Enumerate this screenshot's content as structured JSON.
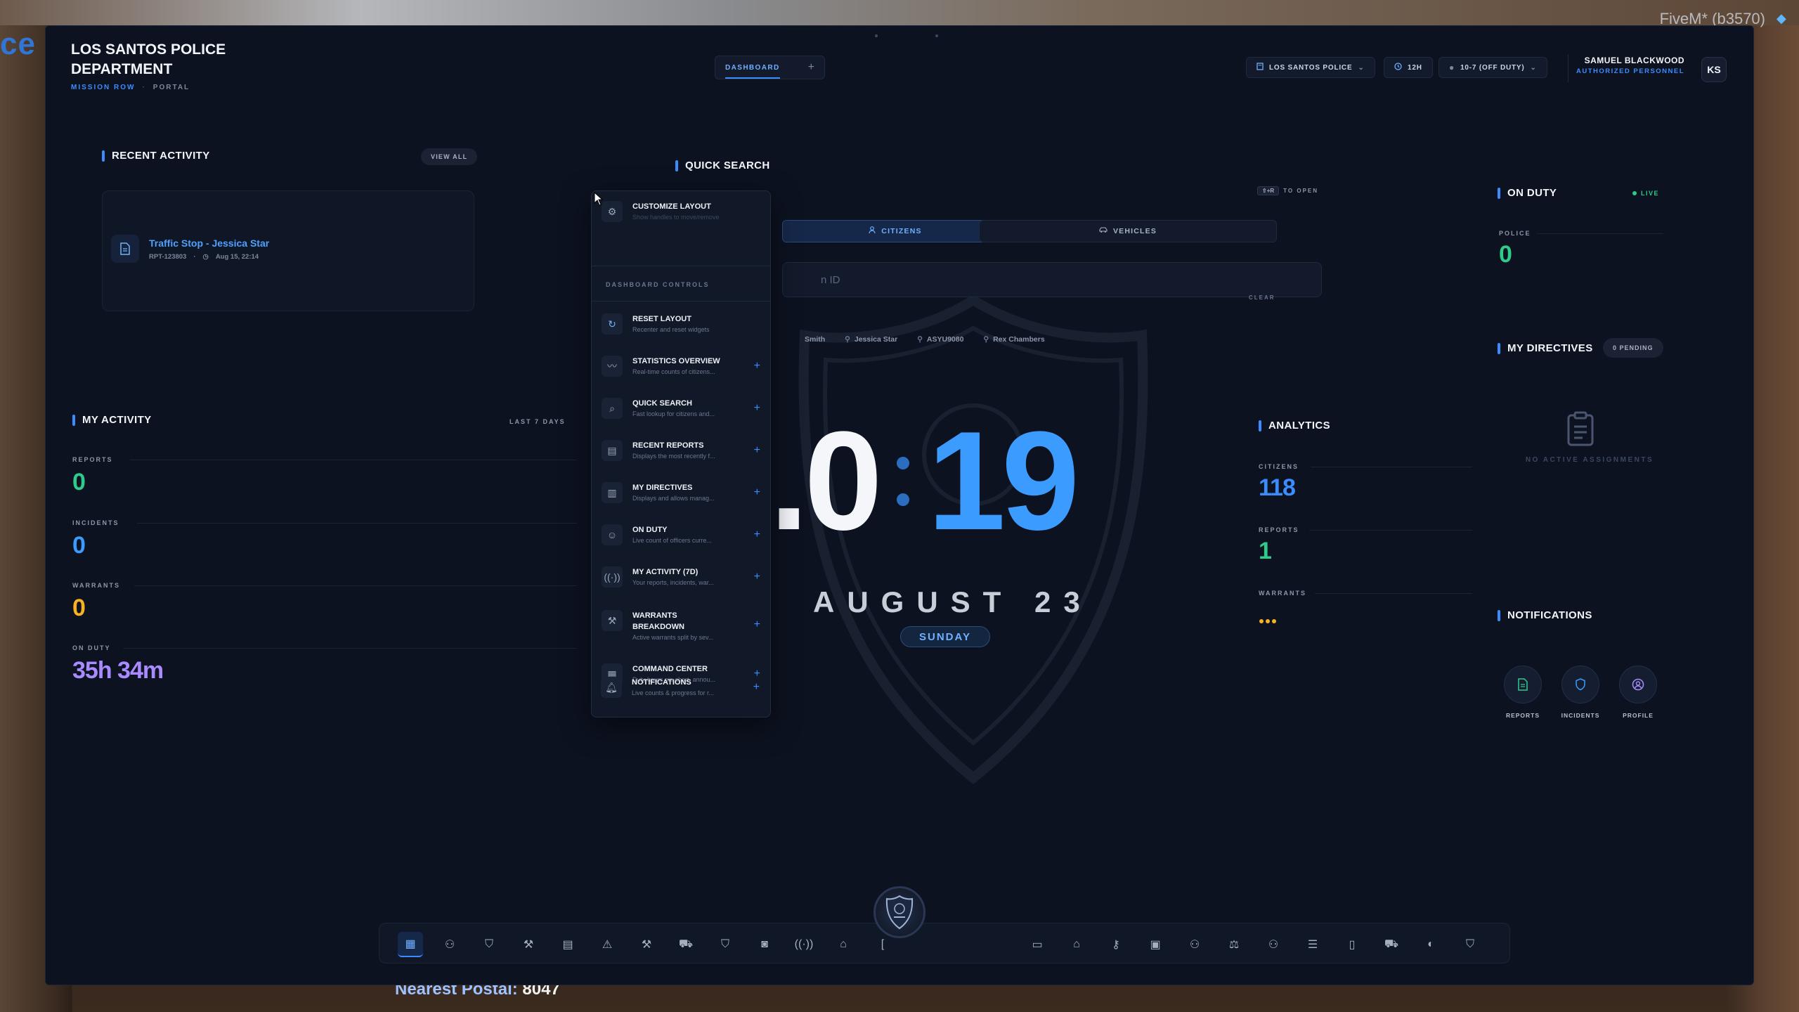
{
  "background": {
    "left_text": "ce S",
    "top_right_text": "_FiveM* (b3570)",
    "bottom_text_label": "Nearest Postal:",
    "bottom_text_value": "8047"
  },
  "header": {
    "title": "LOS SANTOS POLICE DEPARTMENT",
    "sub_primary": "MISSION ROW",
    "sub_separator": "·",
    "sub_secondary": "PORTAL",
    "tab_label": "DASHBOARD",
    "tab_add": "+",
    "department_select": "LOS SANTOS POLICE",
    "time_format": "12H",
    "status_select": "10-7 (OFF DUTY)",
    "user_name": "SAMUEL BLACKWOOD",
    "user_role": "AUTHORIZED PERSONNEL",
    "avatar_initials": "KS"
  },
  "recent_activity": {
    "title": "RECENT ACTIVITY",
    "view_all": "VIEW ALL",
    "item_title": "Traffic Stop - Jessica Star",
    "item_id": "RPT-123803",
    "item_sep": "·",
    "item_time": "Aug 15, 22:14"
  },
  "my_activity": {
    "title": "MY ACTIVITY",
    "range": "LAST 7 DAYS",
    "reports_label": "REPORTS",
    "reports_value": "0",
    "incidents_label": "INCIDENTS",
    "incidents_value": "0",
    "warrants_label": "WARRANTS",
    "warrants_value": "0",
    "on_duty_label": "ON DUTY",
    "on_duty_value": "35h 34m"
  },
  "clock": {
    "hours": ".0",
    "minutes": "19",
    "date": "AUGUST 23",
    "day": "SUNDAY"
  },
  "quick_search": {
    "title": "QUICK SEARCH",
    "shortcut_key": "⇧+R",
    "shortcut_text": "TO OPEN",
    "tab_citizens": "CITIZENS",
    "tab_vehicles": "VEHICLES",
    "input_placeholder": "n ID",
    "clear": "CLEAR",
    "recents": [
      "Smith",
      "Jessica Star",
      "ASYU9080",
      "Rex Chambers"
    ]
  },
  "menu": {
    "customize_title": "CUSTOMIZE LAYOUT",
    "customize_desc": "Show handles to move/remove",
    "section": "DASHBOARD CONTROLS",
    "items": [
      {
        "title": "RESET LAYOUT",
        "desc": "Recenter and reset widgets",
        "icon": "refresh-icon",
        "add": ""
      },
      {
        "title": "STATISTICS OVERVIEW",
        "desc": "Real-time counts of citizens...",
        "icon": "activity-icon",
        "add": "+"
      },
      {
        "title": "QUICK SEARCH",
        "desc": "Fast lookup for citizens and...",
        "icon": "search-icon",
        "add": "+"
      },
      {
        "title": "RECENT REPORTS",
        "desc": "Displays the most recently f...",
        "icon": "document-icon",
        "add": "+"
      },
      {
        "title": "MY DIRECTIVES",
        "desc": "Displays and allows manag...",
        "icon": "clipboard-icon",
        "add": "+"
      },
      {
        "title": "ON DUTY",
        "desc": "Live count of officers curre...",
        "icon": "user-check-icon",
        "add": "+"
      },
      {
        "title": "MY ACTIVITY (7D)",
        "desc": "Your reports, incidents, war...",
        "icon": "radio-icon",
        "add": "+"
      },
      {
        "title": "WARRANTS BREAKDOWN",
        "desc": "Active warrants split by sev...",
        "icon": "gavel-icon",
        "add": "+"
      },
      {
        "title": "COMMAND CENTER",
        "desc": "Duty hours pie chart, annou...",
        "icon": "grid-icon",
        "add": "+"
      },
      {
        "title": "NOTIFICATIONS",
        "desc": "Live counts & progress for r...",
        "icon": "bell-icon",
        "add": "+"
      }
    ]
  },
  "analytics": {
    "title": "ANALYTICS",
    "citizens_label": "CITIZENS",
    "citizens_value": "118",
    "reports_label": "REPORTS",
    "reports_value": "1",
    "warrants_label": "WARRANTS"
  },
  "on_duty": {
    "title": "ON DUTY",
    "live": "LIVE",
    "police_label": "POLICE",
    "police_value": "0"
  },
  "directives": {
    "title": "MY DIRECTIVES",
    "pending": "0 PENDING",
    "empty": "NO ACTIVE ASSIGNMENTS"
  },
  "notifications": {
    "title": "NOTIFICATIONS",
    "reports": "REPORTS",
    "incidents": "INCIDENTS",
    "profile": "PROFILE"
  },
  "colors": {
    "accent": "#3b8dff",
    "green": "#2ecc8a",
    "yellow": "#f5b324",
    "purple": "#a98bff",
    "panel": "#0c1220"
  }
}
